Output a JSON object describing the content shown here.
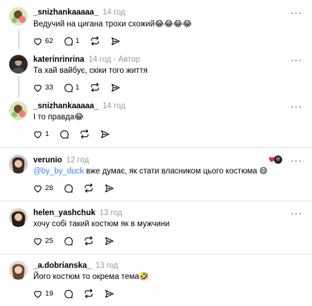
{
  "comments": [
    {
      "username": "_snizhankaaaaa_",
      "time": "14 год",
      "author_tag": "",
      "text": "Ведучий на цигана трохи схожий😂😂😂😂",
      "likes": "62",
      "replies": "1"
    },
    {
      "username": "katerinrinrina",
      "time": "14 год",
      "author_tag": "· Автор",
      "text": "Та хай вайбує, скіки того життя",
      "likes": "33",
      "replies": "1"
    },
    {
      "username": "_snizhankaaaaa_",
      "time": "14 год",
      "author_tag": "",
      "text": "І то правда😂",
      "likes": "1",
      "replies": ""
    },
    {
      "username": "verunio",
      "time": "12 год",
      "author_tag": "",
      "mention": "@by_by_duck",
      "text": " вже думає, як стати власником цього костюма 😄",
      "likes": "28",
      "replies": ""
    },
    {
      "username": "helen_yashchuk",
      "time": "13 год",
      "author_tag": "",
      "text": "хочу собі такий костюм як в мужчини",
      "likes": "25",
      "replies": ""
    },
    {
      "username": "_a.dobrianska_",
      "time": "13 год",
      "author_tag": "",
      "text": "Його костюм то окрема тема🤣",
      "likes": "19",
      "replies": ""
    }
  ],
  "icons": {
    "like": "heart-icon",
    "reply": "comment-bubble-icon",
    "repost": "repost-icon",
    "share": "send-icon",
    "more": "more-dots-icon"
  },
  "more_glyph": "···"
}
